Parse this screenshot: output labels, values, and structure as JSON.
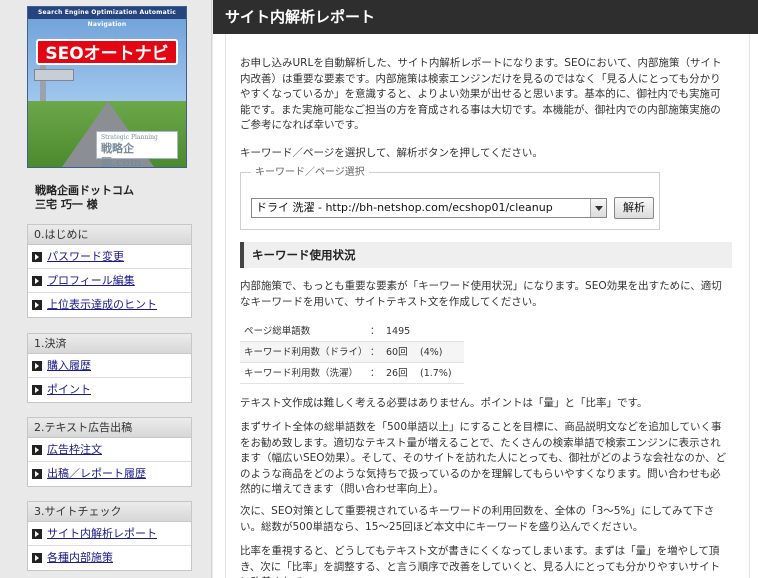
{
  "logo": {
    "tagline": "Search Engine Optimization Automatic Navigation",
    "brand": "SEOオートナビ",
    "plate_small": "Strategic Planning",
    "plate_main": "戦略企画.com"
  },
  "user": {
    "company": "戦略企画ドットコム",
    "name": "三宅 巧一 様"
  },
  "nav": [
    {
      "heading": "0.はじめに",
      "items": [
        "パスワード変更",
        "プロフィール編集",
        "上位表示達成のヒント"
      ]
    },
    {
      "heading": "1.決済",
      "items": [
        "購入履歴",
        "ポイント"
      ]
    },
    {
      "heading": "2.テキスト広告出稿",
      "items": [
        "広告枠注文",
        "出稿／レポート履歴"
      ]
    },
    {
      "heading": "3.サイトチェック",
      "items": [
        "サイト内解析レポート",
        "各種内部施策"
      ]
    }
  ],
  "page": {
    "title": "サイト内解析レポート",
    "intro": "お申し込みURLを自動解析した、サイト内解析レポートになります。SEOにおいて、内部施策（サイト内改善）は重要な要素です。内部施策は検索エンジンだけを見るのではなく「見る人にとっても分かりやすくなっているか」を意識すると、よりよい効果が出せると思います。基本的に、御社内でも実施可能です。また実施可能なご担当の方を育成される事は大切です。本機能が、御社内での内部施策実施のご参考になれば幸いです。",
    "instruction": "キーワード／ページを選択して、解析ボタンを押してください。",
    "selector": {
      "legend": "キーワード／ページ選択",
      "selected": "ドライ 洗濯 - http://bh-netshop.com/ecshop01/cleanup",
      "button": "解析"
    },
    "section_title": "キーワード使用状況",
    "section_intro": "内部施策で、もっとも重要な要素が「キーワード使用状況」になります。SEO効果を出すために、適切なキーワードを用いて、サイトテキスト文を作成してください。",
    "stats": [
      {
        "label": "ページ総単語数",
        "colon": "：",
        "value": "1495",
        "pct": ""
      },
      {
        "label": "キーワード利用数（ドライ）",
        "colon": "：",
        "value": "60回",
        "pct": "(4%)"
      },
      {
        "label": "キーワード利用数（洗濯）",
        "colon": "：",
        "value": "26回",
        "pct": "(1.7%)"
      }
    ],
    "p1": "テキスト文作成は難しく考える必要はありません。ポイントは「量」と「比率」です。",
    "p2": "まずサイト全体の総単語数を「500単語以上」にすることを目標に、商品説明文などを追加していく事をお勧め致します。適切なテキスト量が増えることで、たくさんの検索単語で検索エンジンに表示されます（幅広いSEO効果）。そして、そのサイトを訪れた人にとっても、御社がどのような会社なのか、どのような商品をどのような気持ちで扱っているのかを理解してもらいやすくなります。問い合わせも必然的に増えてきます（問い合わせ率向上）。",
    "p3": "次に、SEO対策として重要視されているキーワードの利用回数を、全体の「3〜5%」にしてみて下さい。総数が500単語なら、15〜25回ほど本文中にキーワードを盛り込んでください。",
    "p4": "比率を重視すると、どうしてもテキスト文が書きにくくなってしまいます。まずは「量」を増やして頂き、次に「比率」を調整する、と言う順序で改善をしていくと、見る人にとっても分かりやすいサイトに改善されて"
  }
}
